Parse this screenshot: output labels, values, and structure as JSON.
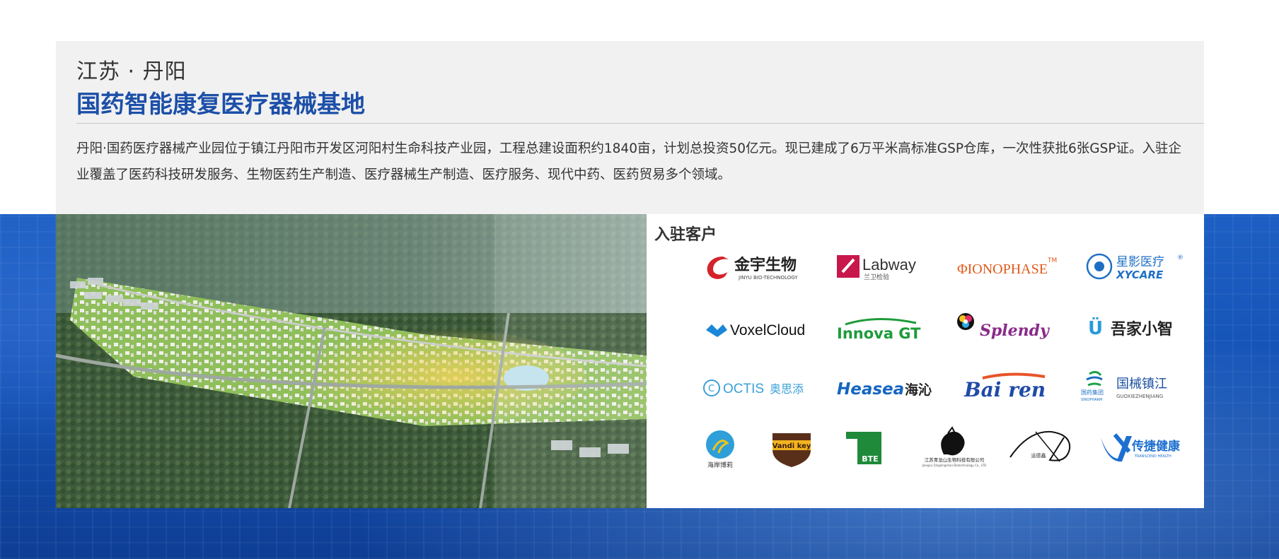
{
  "header": {
    "subtitle": "江苏 · 丹阳",
    "title": "国药智能康复医疗器械基地",
    "description": "丹阳·国药医疗器械产业园位于镇江丹阳市开发区河阳村生命科技产业园，工程总建设面积约1840亩，计划总投资50亿元。现已建成了6万平米高标准GSP仓库，一次性获批6张GSP证。入驻企业覆盖了医药科技研发服务、生物医药生产制造、医疗器械生产制造、医疗服务、现代中药、医药贸易多个领域。"
  },
  "clients": {
    "title": "入驻客户",
    "logos": {
      "jinyu": {
        "main": "金宇生物",
        "sub": "JINYU BIO-TECHNOLOGY"
      },
      "labway": {
        "main": "Labway",
        "sub": "兰卫检验"
      },
      "pioneer": {
        "main": "ΦIONOPHASE",
        "tm": "TM"
      },
      "xycare": {
        "main": "星影医疗",
        "sub": "XYCARE",
        "reg": "®"
      },
      "voxel": {
        "main": "VoxelCloud"
      },
      "innova": {
        "main": "Innova GT"
      },
      "splendy": {
        "main": "Splendy"
      },
      "wujia": {
        "main": "吾家小智"
      },
      "octis": {
        "main": "OCTIS",
        "cn": "奥思添"
      },
      "heasea": {
        "main": "Heasea",
        "cn": "海沁"
      },
      "bairen": {
        "main": "Bai ren"
      },
      "guoxie": {
        "main": "国械镇江",
        "sub": "GUOXIEZHENJIANG",
        "side": "国药集团",
        "side_sub": "SINOPHARM"
      },
      "haian": {
        "main": "海岸博莉"
      },
      "vandi": {
        "main": "Vandi key"
      },
      "bte": {
        "main": "BTE"
      },
      "qingshan": {
        "main": "江苏青龙山生物科技有限公司",
        "sub": "Jiangsu Qinglongshan Biotechnology Co., LTD"
      },
      "tuo": {
        "main": "运德鑫"
      },
      "transceng": {
        "main": "传捷健康",
        "sub": "TRANSCEND HEALTH"
      }
    },
    "colors": {
      "jinyu_red": "#d4232a",
      "labway_red": "#c8174b",
      "pioneer_orange": "#e05a1c",
      "xycare_blue": "#1e6fc4",
      "innova_green": "#1e9b3a",
      "splendy_purple": "#8a2a8a",
      "octis_blue": "#3aa0d8",
      "bairen_blue": "#1f4aa8",
      "transceng_blue": "#1d6fd1"
    }
  }
}
